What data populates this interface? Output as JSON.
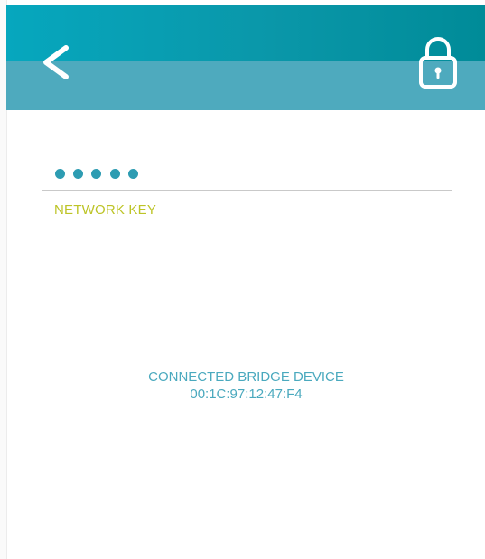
{
  "header": {
    "back_icon": "chevron-left-icon",
    "lock_icon": "lock-icon",
    "top_color": "#0a97a9",
    "bottom_color": "#4eaabe"
  },
  "form": {
    "password_mask": "•••••",
    "password_length": 5,
    "field_label": "NETWORK KEY",
    "label_color": "#bdc427",
    "dot_color": "#2d9cb2"
  },
  "device": {
    "title": "CONNECTED BRIDGE DEVICE",
    "mac_address": "00:1C:97:12:47:F4",
    "text_color": "#4aa9be"
  }
}
